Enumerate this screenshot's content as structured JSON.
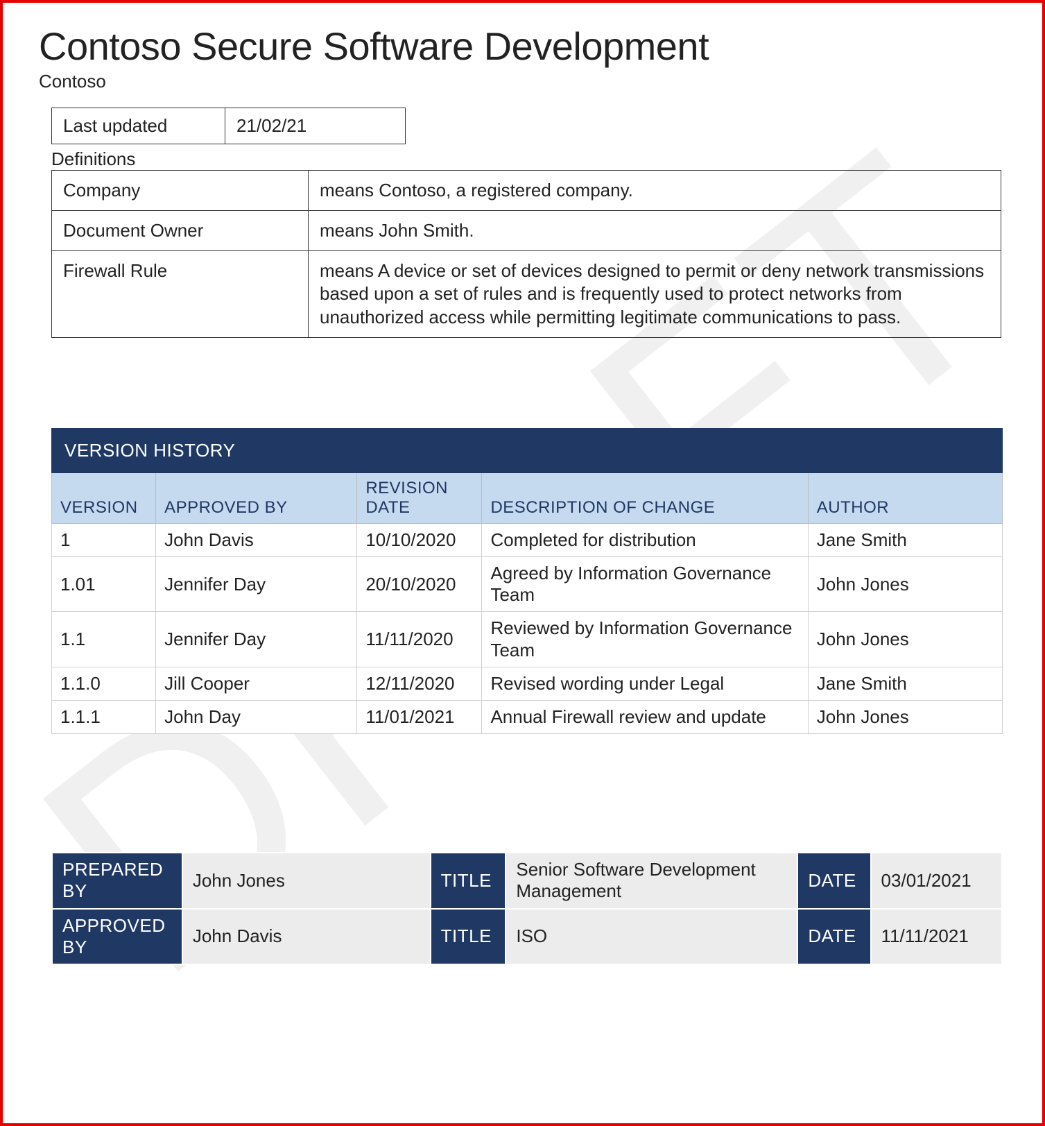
{
  "watermark": "DRAFT",
  "doc": {
    "title": "Contoso Secure Software Development",
    "subtitle": "Contoso"
  },
  "meta": {
    "last_updated_label": "Last updated",
    "last_updated_value": "21/02/21",
    "definitions_label": "Definitions"
  },
  "definitions": [
    {
      "term": "Company",
      "desc": "means Contoso, a registered company."
    },
    {
      "term": "Document Owner",
      "desc": "means John Smith."
    },
    {
      "term": "Firewall Rule",
      "desc": "means A device or set of devices designed to permit or deny network transmissions based upon a set of rules and is frequently used to protect networks from unauthorized access while permitting legitimate communications to pass."
    }
  ],
  "version_history": {
    "title": "VERSION HISTORY",
    "columns": {
      "version": "VERSION",
      "approved_by": "APPROVED BY",
      "revision_date": "REVISION DATE",
      "description": "DESCRIPTION OF CHANGE",
      "author": "AUTHOR"
    },
    "rows": [
      {
        "version": "1",
        "approved_by": "John Davis",
        "revision_date": "10/10/2020",
        "description": "Completed for distribution",
        "author": "Jane Smith"
      },
      {
        "version": "1.01",
        "approved_by": "Jennifer Day",
        "revision_date": "20/10/2020",
        "description": "Agreed by Information Governance Team",
        "author": "John Jones"
      },
      {
        "version": "1.1",
        "approved_by": "Jennifer Day",
        "revision_date": "11/11/2020",
        "description": "Reviewed by Information Governance Team",
        "author": "John Jones"
      },
      {
        "version": "1.1.0",
        "approved_by": "Jill Cooper",
        "revision_date": "12/11/2020",
        "description": "Revised wording under Legal",
        "author": "Jane Smith"
      },
      {
        "version": "1.1.1",
        "approved_by": "John Day",
        "revision_date": "11/01/2021",
        "description": "Annual Firewall review and update",
        "author": "John Jones"
      }
    ]
  },
  "signoff": {
    "prepared_by_label": "PREPARED BY",
    "approved_by_label": "APPROVED BY",
    "title_label": "TITLE",
    "date_label": "DATE",
    "rows": [
      {
        "name": "John Jones",
        "title": "Senior Software Development Management",
        "date": "03/01/2021"
      },
      {
        "name": "John Davis",
        "title": "ISO",
        "date": "11/11/2021"
      }
    ]
  }
}
